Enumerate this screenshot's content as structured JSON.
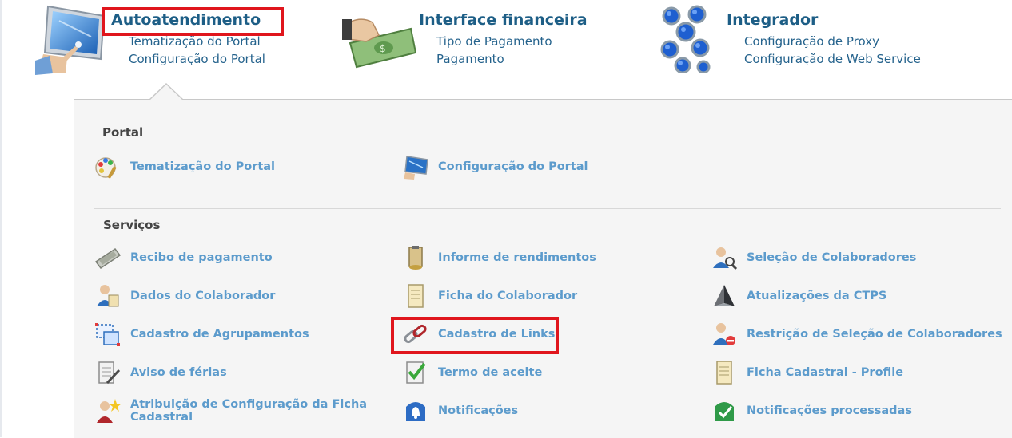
{
  "modules": [
    {
      "title": "Autoatendimento",
      "links": [
        "Tematização do Portal",
        "Configuração do Portal"
      ],
      "icon": "touchscreen-icon"
    },
    {
      "title": "Interface financeira",
      "links": [
        "Tipo de Pagamento",
        "Pagamento"
      ],
      "icon": "money-hand-icon"
    },
    {
      "title": "Integrador",
      "links": [
        "Configuração de Proxy",
        "Configuração de Web Service"
      ],
      "icon": "integrator-blobs-icon"
    }
  ],
  "sections": {
    "portal": {
      "heading": "Portal",
      "items": [
        "Tematização do Portal",
        "Configuração do Portal"
      ]
    },
    "servicos": {
      "heading": "Serviços",
      "items": [
        "Recibo de pagamento",
        "Informe de rendimentos",
        "Seleção de Colaboradores",
        "Dados do Colaborador",
        "Ficha do Colaborador",
        "Atualizações da CTPS",
        "Cadastro de Agrupamentos",
        "Cadastro de Links",
        "Restrição de Seleção de Colaboradores",
        "Aviso de férias",
        "Termo de aceite",
        "Ficha Cadastral - Profile",
        "Atribuição de Configuração da Ficha Cadastral",
        "Notificações",
        "Notificações processadas"
      ]
    }
  },
  "colors": {
    "highlight": "#e0161d",
    "module_title": "#1d5e86",
    "item_label": "#5c9bcc"
  }
}
